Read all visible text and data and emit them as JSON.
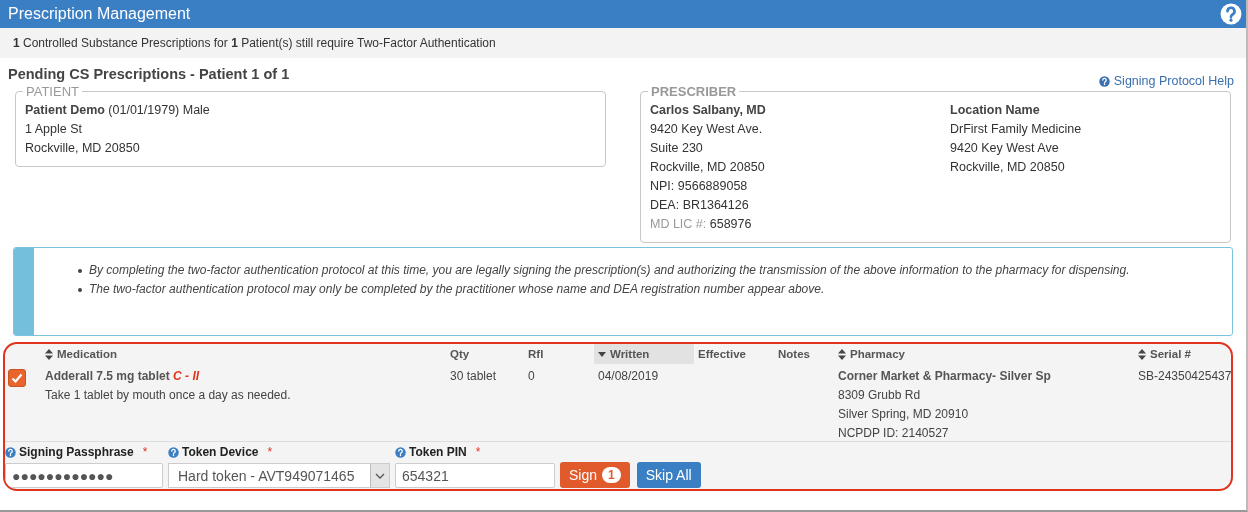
{
  "window": {
    "title": "Prescription Management"
  },
  "summary": "**1** Controlled Substance Prescriptions for **1** Patient(s) still require Two-Factor Authentication",
  "heading": "Pending CS Prescriptions - Patient 1 of 1",
  "help_link": "Signing Protocol Help",
  "patient": {
    "legend": "PATIENT",
    "name": "Patient Demo",
    "details": "(01/01/1979) Male",
    "lines": [
      "1 Apple St",
      "Rockville, MD 20850"
    ]
  },
  "prescriber": {
    "legend": "PRESCRIBER",
    "name": "Carlos Salbany, MD",
    "lines": [
      "9420 Key West Ave.",
      "Suite 230",
      "Rockville, MD 20850",
      "NPI: 9566889058",
      "DEA: BR1364126"
    ],
    "license_label": "MD LIC #:",
    "license": "658976",
    "location_title": "Location Name",
    "location_lines": [
      "DrFirst Family Medicine",
      "9420 Key West Ave",
      "Rockville, MD 20850"
    ]
  },
  "notice": [
    "By completing the two-factor authentication protocol at this time, you are legally signing the prescription(s) and authorizing the transmission of the above information to the pharmacy for dispensing.",
    "The two-factor authentication protocol may only be completed by the practitioner whose name and DEA registration number appear above."
  ],
  "table": {
    "columns": [
      {
        "label": "Medication",
        "kind": "sortable",
        "selected": false
      },
      {
        "label": "Qty",
        "kind": "plain",
        "selected": false
      },
      {
        "label": "Rfl",
        "kind": "plain",
        "selected": false
      },
      {
        "label": "Written",
        "kind": "descending",
        "selected": true
      },
      {
        "label": "Effective",
        "kind": "plain",
        "selected": false
      },
      {
        "label": "Notes",
        "kind": "plain",
        "selected": false
      },
      {
        "label": "Pharmacy",
        "kind": "sortable",
        "selected": false
      },
      {
        "label": "Serial #",
        "kind": "sortable",
        "selected": false
      }
    ],
    "rows": [
      {
        "checked": true,
        "medication": "Adderall 7.5 mg tablet",
        "schedule": "C - II",
        "sig": "Take 1 tablet by mouth once a day as needed.",
        "qty": "30 tablet",
        "rfl": "0",
        "written": "04/08/2019",
        "pharmacy": "Corner Market & Pharmacy- Silver Sp",
        "pharmacy_lines": [
          "8309 Grubb Rd",
          "Silver Spring, MD 20910",
          "NCPDP ID: 2140527"
        ],
        "serial": "SB-24350425437"
      }
    ]
  },
  "form": {
    "fields": [
      {
        "kind": "text",
        "label": "Signing Passphrase",
        "marker": "*",
        "value": "●●●●●●●●●●●●"
      },
      {
        "kind": "select",
        "label": "Token Device",
        "marker": "*",
        "value": "Hard token - AVT949071465"
      },
      {
        "kind": "text",
        "label": "Token PIN",
        "marker": "*",
        "value": "654321"
      }
    ],
    "sign_button": {
      "label": "Sign",
      "count": "1"
    },
    "skip_button": "Skip All"
  }
}
